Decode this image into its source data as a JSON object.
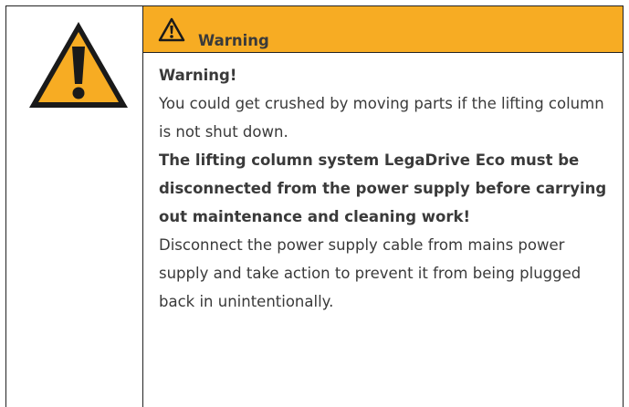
{
  "notice": {
    "header_title": "Warning",
    "heading": "Warning!",
    "hazard_text": "You could get crushed by moving parts if the lifting column is not shut down.",
    "instruction_text": "The lifting column system LegaDrive Eco must be disconnected from the power supply before carrying out maintenance and cleaning work!",
    "action_text": "Disconnect the power supply cable from mains power supply and take action to prevent it from being plugged back in unintentionally.",
    "icons": {
      "large": "warning-triangle-icon",
      "small": "warning-triangle-outline-icon"
    },
    "colors": {
      "header_background": "#f7ac23",
      "triangle_fill": "#f7ac23",
      "border": "#222222",
      "text": "#3a3a3a"
    }
  }
}
